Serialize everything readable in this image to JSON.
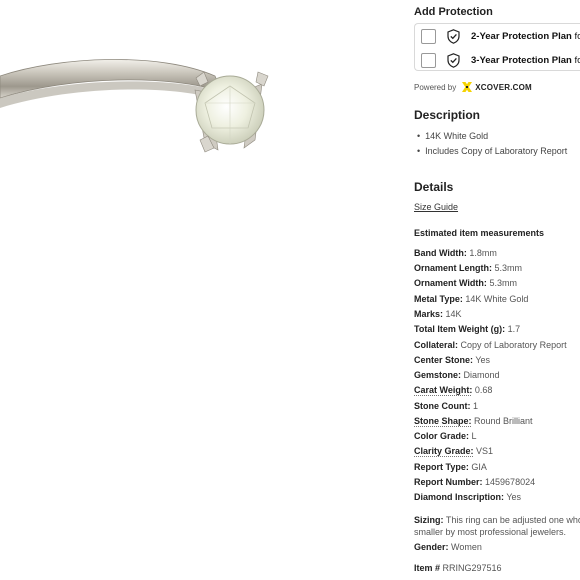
{
  "add_protection": {
    "title": "Add Protection",
    "plans": [
      {
        "name": "2-Year Protection Plan",
        "suffix": "for"
      },
      {
        "name": "3-Year Protection Plan",
        "suffix": "for"
      }
    ],
    "powered_by": "Powered by",
    "provider": "XCOVER.COM"
  },
  "description": {
    "title": "Description",
    "items": [
      "14K White Gold",
      "Includes Copy of Laboratory Report"
    ]
  },
  "details": {
    "title": "Details",
    "size_guide": "Size Guide",
    "measurements_title": "Estimated item measurements",
    "specs": [
      {
        "label": "Band Width:",
        "value": "1.8mm"
      },
      {
        "label": "Ornament Length:",
        "value": "5.3mm"
      },
      {
        "label": "Ornament Width:",
        "value": "5.3mm"
      },
      {
        "label": "Metal Type:",
        "value": "14K White Gold"
      },
      {
        "label": "Marks:",
        "value": "14K"
      },
      {
        "label": "Total Item Weight (g):",
        "value": "1.7"
      },
      {
        "label": "Collateral:",
        "value": "Copy of Laboratory Report"
      },
      {
        "label": "Center Stone:",
        "value": "Yes"
      },
      {
        "label": "Gemstone:",
        "value": "Diamond"
      },
      {
        "label": "Carat Weight:",
        "value": "0.68"
      },
      {
        "label": "Stone Count:",
        "value": "1"
      },
      {
        "label": "Stone Shape:",
        "value": "Round Brilliant"
      },
      {
        "label": "Color Grade:",
        "value": "L"
      },
      {
        "label": "Clarity Grade:",
        "value": "VS1"
      },
      {
        "label": "Report Type:",
        "value": "GIA"
      },
      {
        "label": "Report Number:",
        "value": "1459678024"
      },
      {
        "label": "Diamond Inscription:",
        "value": "Yes"
      }
    ],
    "sizing_label": "Sizing:",
    "sizing_line1": "This ring can be adjusted one whole",
    "sizing_line2": "smaller by most professional jewelers.",
    "gender_label": "Gender:",
    "gender_value": "Women",
    "item_label": "Item #",
    "item_value": "RRING297516"
  },
  "colors": {
    "accent_logo": "#f5d300",
    "text_dark": "#222222",
    "text_muted": "#555555",
    "border": "#d9d9d9"
  },
  "icons": [
    "shield-check-icon",
    "xcover-logo-icon",
    "checkbox"
  ]
}
